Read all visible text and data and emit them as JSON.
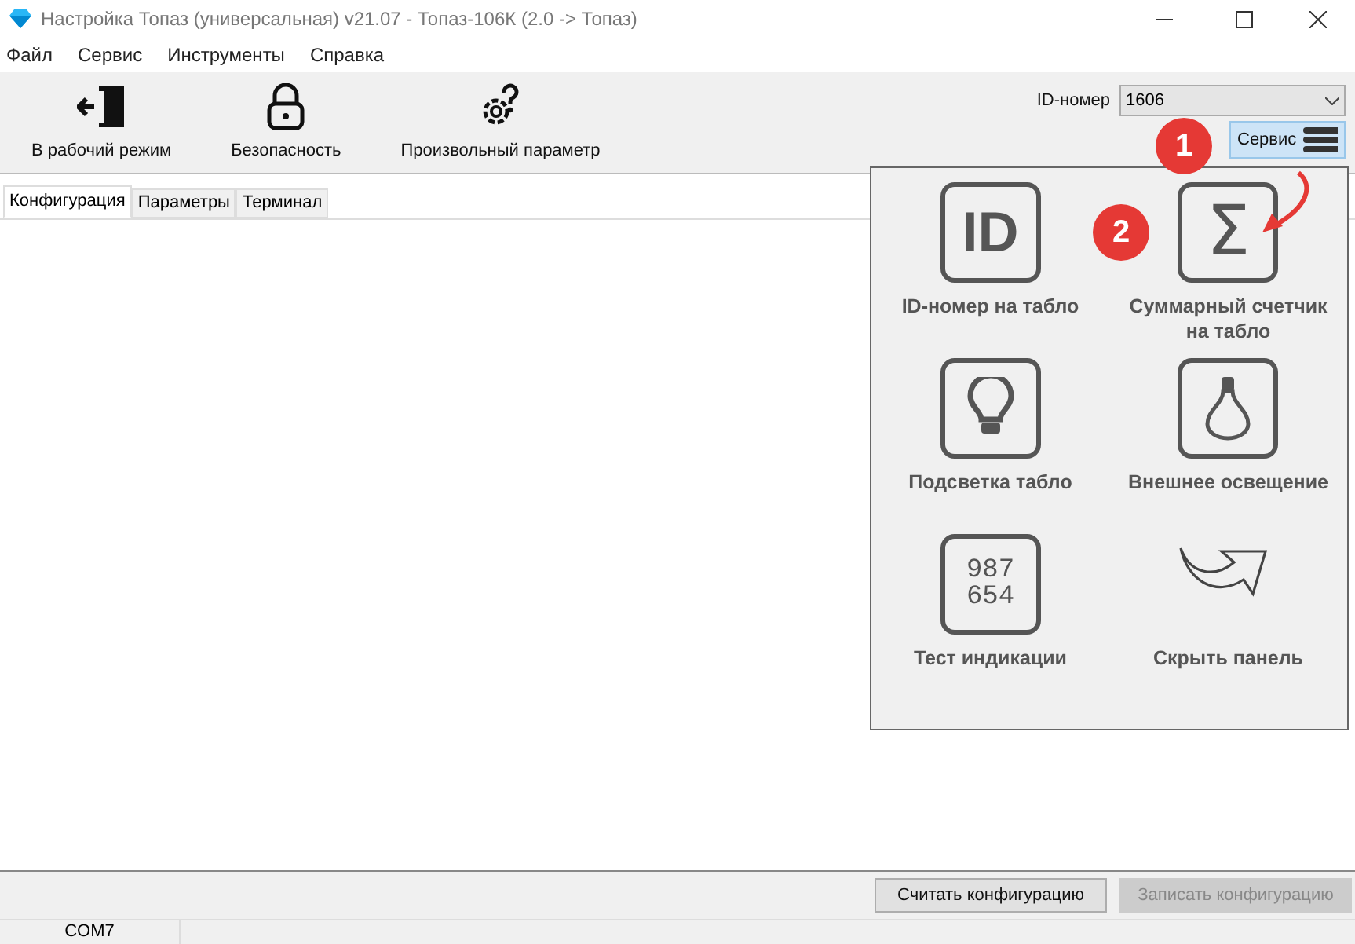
{
  "window": {
    "title": "Настройка Топаз (универсальная) v21.07 - Топаз-106К (2.0 -> Топаз)"
  },
  "menu": [
    "Файл",
    "Сервис",
    "Инструменты",
    "Справка"
  ],
  "toolbar": [
    {
      "kind": "exit",
      "label": "В рабочий режим"
    },
    {
      "kind": "lock",
      "label": "Безопасность"
    },
    {
      "kind": "gear-question",
      "label": "Произвольный параметр"
    }
  ],
  "id_field": {
    "label": "ID-номер",
    "value": "1606"
  },
  "service_button": {
    "label": "Сервис",
    "expanded": true
  },
  "tabs": [
    {
      "label": "Конфигурация",
      "selected": true
    },
    {
      "label": "Параметры",
      "selected": false
    },
    {
      "label": "Терминал",
      "selected": false
    }
  ],
  "service_panel": {
    "tiles": [
      {
        "kind": "id",
        "display": "ID",
        "label": "ID-номер на табло"
      },
      {
        "kind": "sigma",
        "display": "Σ",
        "label": "Суммарный счетчик на табло"
      },
      {
        "kind": "bulb",
        "label": "Подсветка табло"
      },
      {
        "kind": "bulb-outline",
        "label": "Внешнее освещение"
      },
      {
        "kind": "digits",
        "display": "987 654",
        "label": "Тест индикации"
      },
      {
        "kind": "arrow",
        "label": "Скрыть панель"
      }
    ]
  },
  "annotations": [
    {
      "label": "1"
    },
    {
      "label": "2"
    }
  ],
  "buttons": [
    {
      "label": "Считать конфигурацию",
      "disabled": false
    },
    {
      "label": "Записать конфигурацию",
      "disabled": true
    }
  ],
  "status_bar": {
    "port": "COM7"
  }
}
